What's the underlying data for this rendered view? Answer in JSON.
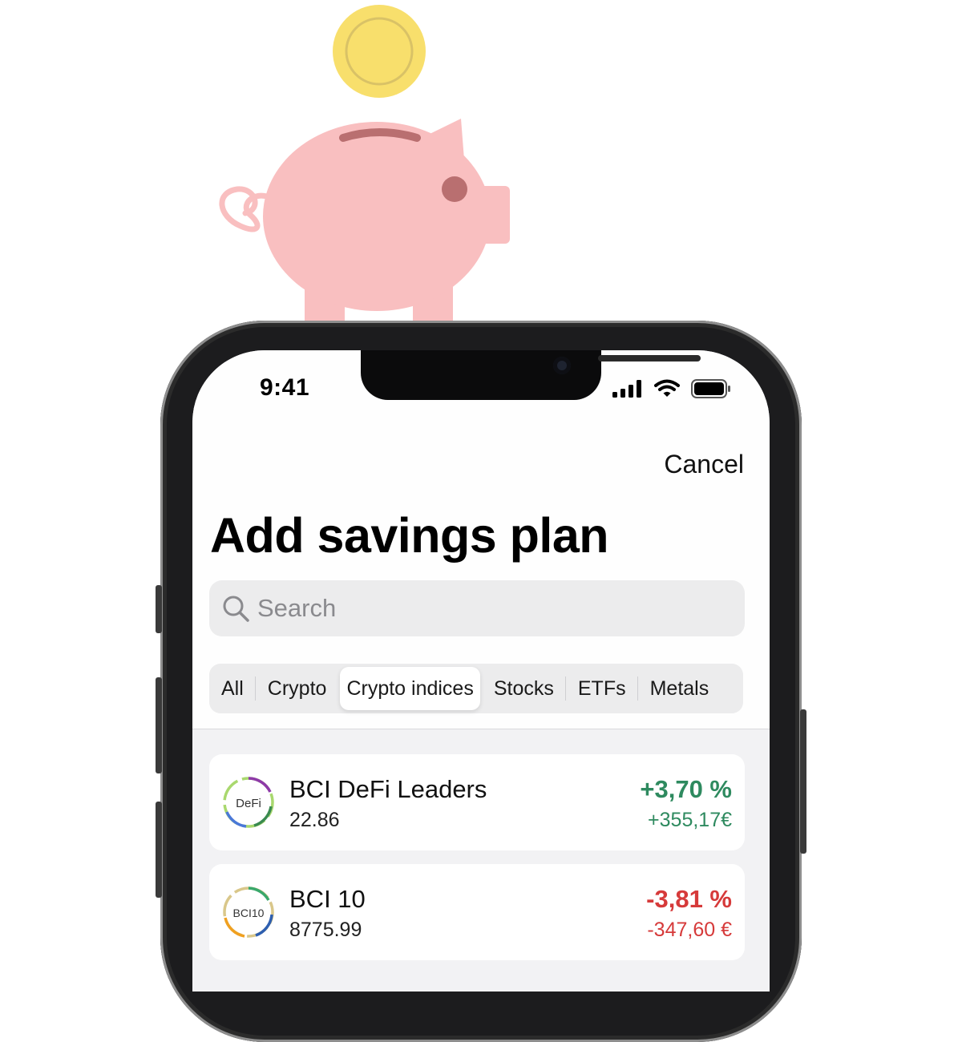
{
  "illustration": {
    "piggy_icon": "piggy-bank-icon",
    "coin_icon": "coin-icon"
  },
  "status_bar": {
    "time": "9:41",
    "icons": [
      "signal-icon",
      "wifi-icon",
      "battery-icon"
    ]
  },
  "header": {
    "cancel_label": "Cancel",
    "title": "Add savings plan"
  },
  "search": {
    "placeholder": "Search",
    "icon": "search-icon"
  },
  "filters": {
    "selected": "Crypto indices",
    "items": [
      "All",
      "Crypto",
      "Crypto indices",
      "Stocks",
      "ETFs",
      "Metals"
    ]
  },
  "assets": [
    {
      "logo_text": "DeFi",
      "name": "BCI DeFi Leaders",
      "price": "22.86",
      "change_pct": "+3,70 %",
      "change_abs": "+355,17€",
      "trend": "up"
    },
    {
      "logo_text": "BCI10",
      "name": "BCI 10",
      "price": "8775.99",
      "change_pct": "-3,81 %",
      "change_abs": "-347,60 €",
      "trend": "down"
    }
  ],
  "colors": {
    "positive": "#2e8a5f",
    "negative": "#d63a3a",
    "piggy": "#f9bfc0",
    "coin": "#f8df6c"
  }
}
